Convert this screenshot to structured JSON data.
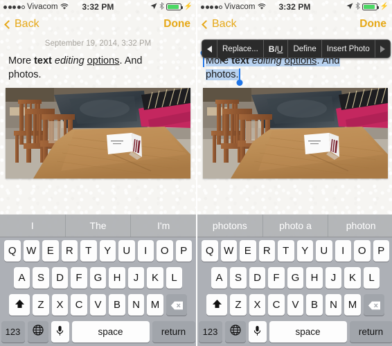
{
  "status_bar": {
    "signal_dots_filled": 4,
    "signal_dots_total": 5,
    "carrier": "Vivacom",
    "wifi_icon": "wifi-icon",
    "time": "3:32 PM",
    "location_icon": "location-arrow-icon",
    "bluetooth_icon": "bluetooth-icon",
    "battery_icon": "battery-icon",
    "charging_icon": "lightning-bolt-icon",
    "battery_color": "#4cd764"
  },
  "nav": {
    "back_label": "Back",
    "back_icon": "chevron-left-icon",
    "done_label": "Done",
    "accent_color": "#e6a817"
  },
  "note": {
    "date": "September 19, 2014, 3:32 PM",
    "line1_plain": "More ",
    "line1_bold": "text",
    "line1_space1": " ",
    "line1_italic": "editing",
    "line1_space2": " ",
    "line1_underline": "options",
    "line1_tail": ". And",
    "line2": "photos.",
    "photo_alt": "photo-wooden-chairs-and-table"
  },
  "edit_menu": {
    "prev_arrow": "triangle-left-icon",
    "replace_label": "Replace...",
    "format_b": "B",
    "format_i": "I",
    "format_u": "U",
    "define_label": "Define",
    "insert_photo_label": "Insert Photo",
    "next_arrow": "triangle-right-icon",
    "background": "#2b2b2b"
  },
  "selection": {
    "handle_color": "#2076e8",
    "highlight_color": "#b8d2f0",
    "start_handle": "selection-start-handle",
    "end_handle": "selection-end-handle"
  },
  "keyboard": {
    "suggestions_left": [
      "I",
      "The",
      "I'm"
    ],
    "suggestions_right": [
      "photons",
      "photo a",
      "photon"
    ],
    "row1": [
      "Q",
      "W",
      "E",
      "R",
      "T",
      "Y",
      "U",
      "I",
      "O",
      "P"
    ],
    "row2": [
      "A",
      "S",
      "D",
      "F",
      "G",
      "H",
      "J",
      "K",
      "L"
    ],
    "row3": [
      "Z",
      "X",
      "C",
      "V",
      "B",
      "N",
      "M"
    ],
    "shift_icon": "shift-arrow-icon",
    "delete_icon": "backspace-icon",
    "numbers_label": "123",
    "globe_icon": "globe-icon",
    "mic_icon": "microphone-icon",
    "space_label": "space",
    "return_label": "return"
  }
}
